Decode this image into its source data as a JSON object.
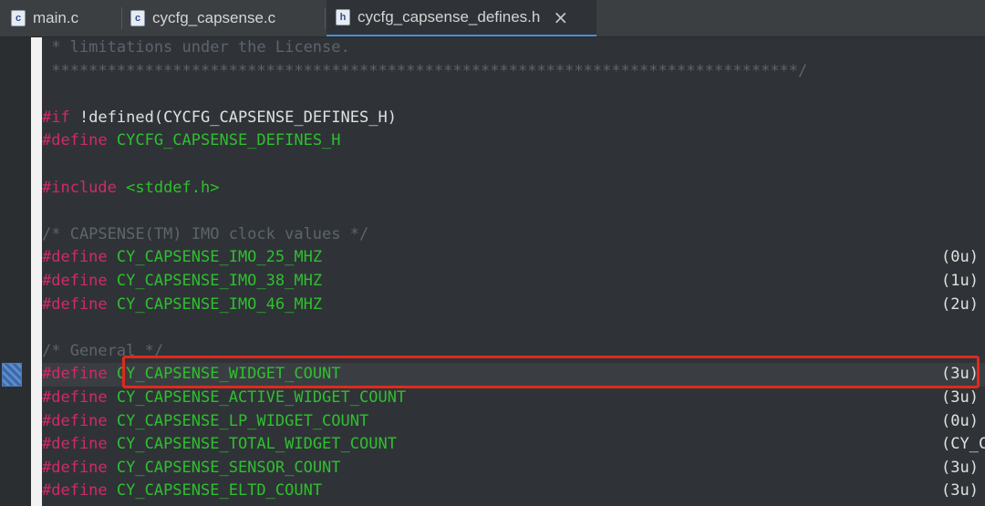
{
  "tabs": [
    {
      "icon": "c",
      "label": "main.c"
    },
    {
      "icon": "c",
      "label": "cycfg_capsense.c"
    },
    {
      "icon": "h",
      "label": "cycfg_capsense_defines.h",
      "close": "×"
    }
  ],
  "lines": [
    {
      "comment": " * limitations under the License."
    },
    {
      "comment": " ********************************************************************************/"
    },
    {},
    {
      "kw": "#if",
      "text": " !defined(CYCFG_CAPSENSE_DEFINES_H)"
    },
    {
      "kw": "#define",
      "macro": " CYCFG_CAPSENSE_DEFINES_H"
    },
    {},
    {
      "kw": "#include",
      "macro": " <stddef.h>"
    },
    {},
    {
      "comment": "/* CAPSENSE(TM) IMO clock values */"
    },
    {
      "kw": "#define",
      "macro": " CY_CAPSENSE_IMO_25_MHZ",
      "value": "(0u)"
    },
    {
      "kw": "#define",
      "macro": " CY_CAPSENSE_IMO_38_MHZ",
      "value": "(1u)"
    },
    {
      "kw": "#define",
      "macro": " CY_CAPSENSE_IMO_46_MHZ",
      "value": "(2u)"
    },
    {},
    {
      "comment": "/* General */"
    },
    {
      "kw": "#define",
      "macro": " CY_CAPSENSE_WIDGET_COUNT",
      "value": "(3u)",
      "current": true
    },
    {
      "kw": "#define",
      "macro": " CY_CAPSENSE_ACTIVE_WIDGET_COUNT",
      "value": "(3u)"
    },
    {
      "kw": "#define",
      "macro": " CY_CAPSENSE_LP_WIDGET_COUNT",
      "value": "(0u)"
    },
    {
      "kw": "#define",
      "macro": " CY_CAPSENSE_TOTAL_WIDGET_COUNT",
      "value": "(CY_C"
    },
    {
      "kw": "#define",
      "macro": " CY_CAPSENSE_SENSOR_COUNT",
      "value": "(3u)"
    },
    {
      "kw": "#define",
      "macro": " CY_CAPSENSE_ELTD_COUNT",
      "value": "(3u)"
    }
  ]
}
